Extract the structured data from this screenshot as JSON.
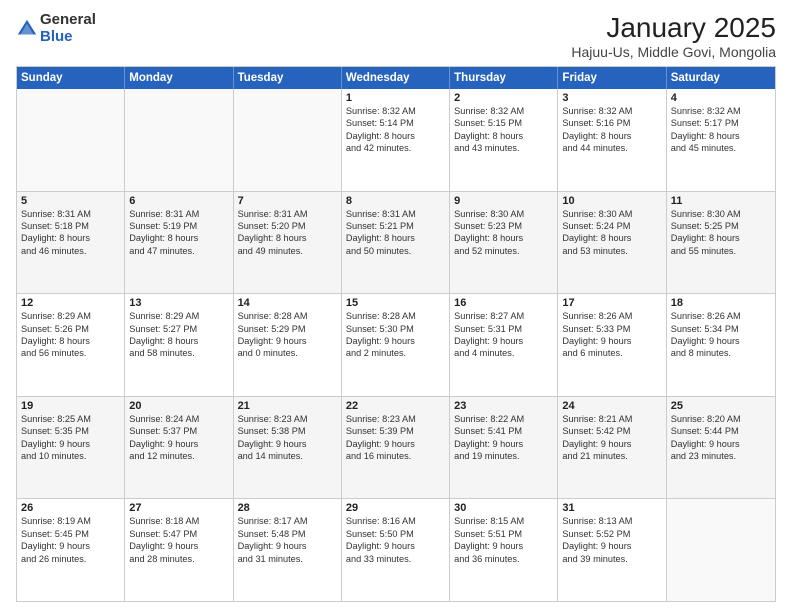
{
  "logo": {
    "general": "General",
    "blue": "Blue"
  },
  "title": "January 2025",
  "subtitle": "Hajuu-Us, Middle Govi, Mongolia",
  "headers": [
    "Sunday",
    "Monday",
    "Tuesday",
    "Wednesday",
    "Thursday",
    "Friday",
    "Saturday"
  ],
  "weeks": [
    [
      {
        "day": "",
        "lines": []
      },
      {
        "day": "",
        "lines": []
      },
      {
        "day": "",
        "lines": []
      },
      {
        "day": "1",
        "lines": [
          "Sunrise: 8:32 AM",
          "Sunset: 5:14 PM",
          "Daylight: 8 hours",
          "and 42 minutes."
        ]
      },
      {
        "day": "2",
        "lines": [
          "Sunrise: 8:32 AM",
          "Sunset: 5:15 PM",
          "Daylight: 8 hours",
          "and 43 minutes."
        ]
      },
      {
        "day": "3",
        "lines": [
          "Sunrise: 8:32 AM",
          "Sunset: 5:16 PM",
          "Daylight: 8 hours",
          "and 44 minutes."
        ]
      },
      {
        "day": "4",
        "lines": [
          "Sunrise: 8:32 AM",
          "Sunset: 5:17 PM",
          "Daylight: 8 hours",
          "and 45 minutes."
        ]
      }
    ],
    [
      {
        "day": "5",
        "lines": [
          "Sunrise: 8:31 AM",
          "Sunset: 5:18 PM",
          "Daylight: 8 hours",
          "and 46 minutes."
        ]
      },
      {
        "day": "6",
        "lines": [
          "Sunrise: 8:31 AM",
          "Sunset: 5:19 PM",
          "Daylight: 8 hours",
          "and 47 minutes."
        ]
      },
      {
        "day": "7",
        "lines": [
          "Sunrise: 8:31 AM",
          "Sunset: 5:20 PM",
          "Daylight: 8 hours",
          "and 49 minutes."
        ]
      },
      {
        "day": "8",
        "lines": [
          "Sunrise: 8:31 AM",
          "Sunset: 5:21 PM",
          "Daylight: 8 hours",
          "and 50 minutes."
        ]
      },
      {
        "day": "9",
        "lines": [
          "Sunrise: 8:30 AM",
          "Sunset: 5:23 PM",
          "Daylight: 8 hours",
          "and 52 minutes."
        ]
      },
      {
        "day": "10",
        "lines": [
          "Sunrise: 8:30 AM",
          "Sunset: 5:24 PM",
          "Daylight: 8 hours",
          "and 53 minutes."
        ]
      },
      {
        "day": "11",
        "lines": [
          "Sunrise: 8:30 AM",
          "Sunset: 5:25 PM",
          "Daylight: 8 hours",
          "and 55 minutes."
        ]
      }
    ],
    [
      {
        "day": "12",
        "lines": [
          "Sunrise: 8:29 AM",
          "Sunset: 5:26 PM",
          "Daylight: 8 hours",
          "and 56 minutes."
        ]
      },
      {
        "day": "13",
        "lines": [
          "Sunrise: 8:29 AM",
          "Sunset: 5:27 PM",
          "Daylight: 8 hours",
          "and 58 minutes."
        ]
      },
      {
        "day": "14",
        "lines": [
          "Sunrise: 8:28 AM",
          "Sunset: 5:29 PM",
          "Daylight: 9 hours",
          "and 0 minutes."
        ]
      },
      {
        "day": "15",
        "lines": [
          "Sunrise: 8:28 AM",
          "Sunset: 5:30 PM",
          "Daylight: 9 hours",
          "and 2 minutes."
        ]
      },
      {
        "day": "16",
        "lines": [
          "Sunrise: 8:27 AM",
          "Sunset: 5:31 PM",
          "Daylight: 9 hours",
          "and 4 minutes."
        ]
      },
      {
        "day": "17",
        "lines": [
          "Sunrise: 8:26 AM",
          "Sunset: 5:33 PM",
          "Daylight: 9 hours",
          "and 6 minutes."
        ]
      },
      {
        "day": "18",
        "lines": [
          "Sunrise: 8:26 AM",
          "Sunset: 5:34 PM",
          "Daylight: 9 hours",
          "and 8 minutes."
        ]
      }
    ],
    [
      {
        "day": "19",
        "lines": [
          "Sunrise: 8:25 AM",
          "Sunset: 5:35 PM",
          "Daylight: 9 hours",
          "and 10 minutes."
        ]
      },
      {
        "day": "20",
        "lines": [
          "Sunrise: 8:24 AM",
          "Sunset: 5:37 PM",
          "Daylight: 9 hours",
          "and 12 minutes."
        ]
      },
      {
        "day": "21",
        "lines": [
          "Sunrise: 8:23 AM",
          "Sunset: 5:38 PM",
          "Daylight: 9 hours",
          "and 14 minutes."
        ]
      },
      {
        "day": "22",
        "lines": [
          "Sunrise: 8:23 AM",
          "Sunset: 5:39 PM",
          "Daylight: 9 hours",
          "and 16 minutes."
        ]
      },
      {
        "day": "23",
        "lines": [
          "Sunrise: 8:22 AM",
          "Sunset: 5:41 PM",
          "Daylight: 9 hours",
          "and 19 minutes."
        ]
      },
      {
        "day": "24",
        "lines": [
          "Sunrise: 8:21 AM",
          "Sunset: 5:42 PM",
          "Daylight: 9 hours",
          "and 21 minutes."
        ]
      },
      {
        "day": "25",
        "lines": [
          "Sunrise: 8:20 AM",
          "Sunset: 5:44 PM",
          "Daylight: 9 hours",
          "and 23 minutes."
        ]
      }
    ],
    [
      {
        "day": "26",
        "lines": [
          "Sunrise: 8:19 AM",
          "Sunset: 5:45 PM",
          "Daylight: 9 hours",
          "and 26 minutes."
        ]
      },
      {
        "day": "27",
        "lines": [
          "Sunrise: 8:18 AM",
          "Sunset: 5:47 PM",
          "Daylight: 9 hours",
          "and 28 minutes."
        ]
      },
      {
        "day": "28",
        "lines": [
          "Sunrise: 8:17 AM",
          "Sunset: 5:48 PM",
          "Daylight: 9 hours",
          "and 31 minutes."
        ]
      },
      {
        "day": "29",
        "lines": [
          "Sunrise: 8:16 AM",
          "Sunset: 5:50 PM",
          "Daylight: 9 hours",
          "and 33 minutes."
        ]
      },
      {
        "day": "30",
        "lines": [
          "Sunrise: 8:15 AM",
          "Sunset: 5:51 PM",
          "Daylight: 9 hours",
          "and 36 minutes."
        ]
      },
      {
        "day": "31",
        "lines": [
          "Sunrise: 8:13 AM",
          "Sunset: 5:52 PM",
          "Daylight: 9 hours",
          "and 39 minutes."
        ]
      },
      {
        "day": "",
        "lines": []
      }
    ]
  ]
}
